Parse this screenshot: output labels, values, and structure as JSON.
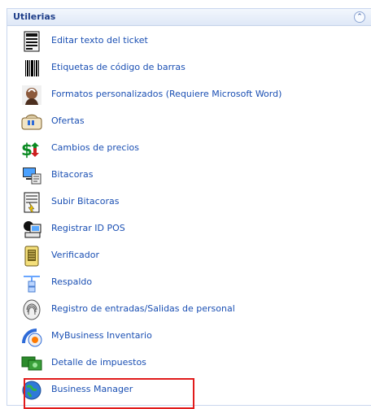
{
  "panel": {
    "title": "Utilerias",
    "collapse_icon": "double-chevron-up-icon"
  },
  "items": [
    {
      "label": "Editar texto del ticket",
      "icon": "ticket-icon"
    },
    {
      "label": "Etiquetas de código de barras",
      "icon": "barcode-icon"
    },
    {
      "label": "Formatos personalizados (Requiere Microsoft Word)",
      "icon": "person-photo-icon"
    },
    {
      "label": "Ofertas",
      "icon": "offers-icon"
    },
    {
      "label": "Cambios de precios",
      "icon": "price-change-icon"
    },
    {
      "label": "Bitacoras",
      "icon": "logbook-computer-icon"
    },
    {
      "label": "Subir Bitacoras",
      "icon": "upload-logs-icon"
    },
    {
      "label": "Registrar ID POS",
      "icon": "register-pos-icon"
    },
    {
      "label": "Verificador",
      "icon": "checker-device-icon"
    },
    {
      "label": "Respaldo",
      "icon": "backup-icon"
    },
    {
      "label": "Registro de entradas/Salidas de personal",
      "icon": "fingerprint-icon"
    },
    {
      "label": "MyBusiness Inventario",
      "icon": "inventory-icon"
    },
    {
      "label": "Detalle de impuestos",
      "icon": "tax-detail-icon"
    },
    {
      "label": "Business Manager",
      "icon": "globe-icon"
    }
  ],
  "highlight": {
    "target": "Business Manager",
    "color": "#e11b1b"
  }
}
